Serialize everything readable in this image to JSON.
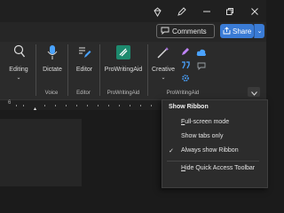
{
  "titlebar": {
    "icons": [
      "diamond-icon",
      "pen-icon",
      "minimize-icon",
      "restore-icon",
      "close-icon"
    ]
  },
  "toolbar": {
    "comments_label": "Comments",
    "share_label": "Share"
  },
  "ribbon": {
    "editing_label": "Editing",
    "dictate_label": "Dictate",
    "editor_label": "Editor",
    "prowritingaid_label": "ProWritingAid",
    "creative_label": "Creative",
    "groups": {
      "voice": "Voice",
      "editor": "Editor",
      "prowritingaid": "ProWritingAid",
      "prowritingaid2": "ProWritingAid"
    }
  },
  "ruler": {
    "start": "6"
  },
  "menu": {
    "title": "Show Ribbon",
    "items": [
      {
        "prefix": "",
        "underline": "F",
        "rest": "ull-screen mode",
        "checked": false
      },
      {
        "prefix": "",
        "underline": "",
        "rest": "Show tabs only",
        "checked": false
      },
      {
        "prefix": "",
        "underline": "",
        "rest": "Always show Ribbon",
        "checked": true
      },
      {
        "prefix": "",
        "underline": "H",
        "rest": "ide Quick Access Toolbar",
        "checked": false
      }
    ],
    "check": "✓"
  },
  "colors": {
    "accent": "#3a7bd5",
    "pwa_green": "#1d8a6e",
    "dictate_blue": "#4aa3ff"
  }
}
